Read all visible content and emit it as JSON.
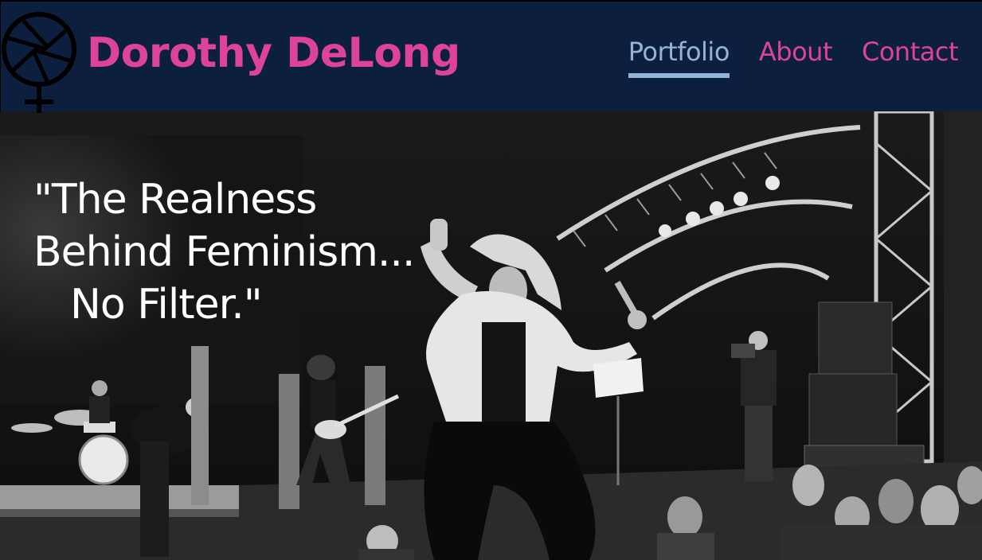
{
  "site": {
    "title": "Dorothy DeLong",
    "logo_icon": "camera-aperture-venus-icon"
  },
  "nav": {
    "items": [
      {
        "label": "Portfolio",
        "active": true
      },
      {
        "label": "About",
        "active": false
      },
      {
        "label": "Contact",
        "active": false
      }
    ]
  },
  "hero": {
    "quote_line1": "\"The Realness",
    "quote_line2": "Behind Feminism...",
    "quote_line3": "No Filter.\"",
    "image": "black-and-white-concert-stage-performer-photo"
  },
  "colors": {
    "header_bg": "#0d1f3f",
    "brand_pink": "#dd4499",
    "active_blue": "#93b4d9",
    "hero_text": "#ffffff"
  }
}
